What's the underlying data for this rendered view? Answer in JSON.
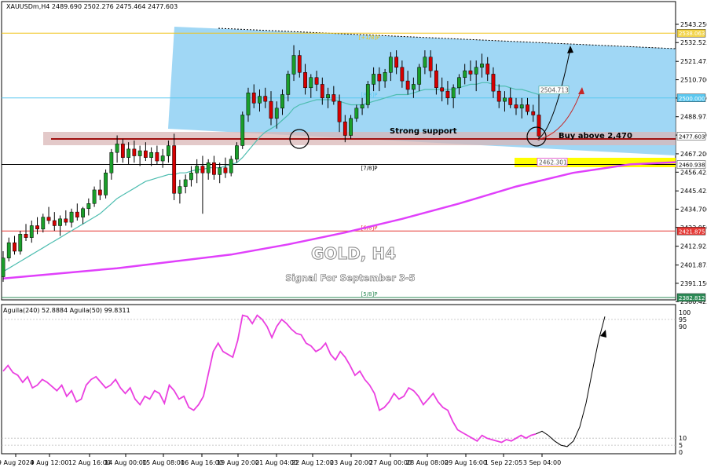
{
  "chart_data": {
    "type": "candlestick",
    "header": "XAUUSDm,H4  2489.690 2502.276 2475.464 2477.603",
    "title": "GOLD, H4",
    "subtitle": "Signal For September 3-5",
    "annotations": {
      "support": "Strong support",
      "buy": "Buy above 2,470"
    },
    "price_axis": {
      "ylim": [
        2380.5,
        2552
      ],
      "ticks": [
        "2543.250",
        "2532.525",
        "2521.475",
        "2510.700",
        "2499.950",
        "2488.975",
        "2478.200",
        "2467.200",
        "2456.425",
        "2445.425",
        "2434.700",
        "2423.950",
        "2412.925",
        "2401.875",
        "2391.150",
        "2380.425"
      ]
    },
    "price_tags": [
      {
        "value": 2538.063,
        "text": "2538.063",
        "bg": "#f2d44a",
        "fg": "#ffffff"
      },
      {
        "value": 2500.0,
        "text": "2500.000",
        "bg": "#5bc8f0",
        "fg": "#ffffff"
      },
      {
        "value": 2477.603,
        "text": "2477.603",
        "bg": "#ffffff",
        "fg": "#000000"
      },
      {
        "value": 2460.938,
        "text": "2460.938",
        "bg": "#ffffff",
        "fg": "#000000"
      },
      {
        "value": 2421.875,
        "text": "2421.875",
        "bg": "#e53935",
        "fg": "#ffffff"
      },
      {
        "value": 2382.812,
        "text": "2382.812",
        "bg": "#2e8b57",
        "fg": "#ffffff"
      }
    ],
    "murrey_levels": [
      {
        "label": "[+1/8]P",
        "value": 2538.063,
        "color": "#f0c419"
      },
      {
        "label": "[8/8]P",
        "value": 2500.0,
        "color": "#5bc8f0"
      },
      {
        "label": "[7/8]P",
        "value": 2460.938,
        "color": "#000000"
      },
      {
        "label": "[6/8]P",
        "value": 2421.875,
        "color": "#e53935"
      },
      {
        "label": "[5/8]P",
        "value": 2382.812,
        "color": "#2e8b57"
      }
    ],
    "ma_labels": [
      {
        "text": "2504.713",
        "value": 2504.713,
        "color": "#5ab4ac"
      },
      {
        "text": "2462.301",
        "value": 2462.301,
        "color": "#e040fb"
      }
    ],
    "candles": [
      [
        2395,
        2410,
        2392,
        2406
      ],
      [
        2406,
        2418,
        2404,
        2415
      ],
      [
        2415,
        2419,
        2408,
        2410
      ],
      [
        2410,
        2422,
        2408,
        2420
      ],
      [
        2420,
        2426,
        2416,
        2418
      ],
      [
        2418,
        2428,
        2415,
        2425
      ],
      [
        2425,
        2430,
        2420,
        2423
      ],
      [
        2423,
        2432,
        2421,
        2430
      ],
      [
        2430,
        2436,
        2426,
        2428
      ],
      [
        2428,
        2433,
        2422,
        2425
      ],
      [
        2425,
        2431,
        2419,
        2429
      ],
      [
        2429,
        2434,
        2425,
        2427
      ],
      [
        2427,
        2435,
        2424,
        2433
      ],
      [
        2433,
        2438,
        2428,
        2430
      ],
      [
        2430,
        2436,
        2426,
        2435
      ],
      [
        2435,
        2441,
        2431,
        2438
      ],
      [
        2438,
        2448,
        2436,
        2446
      ],
      [
        2446,
        2452,
        2440,
        2443
      ],
      [
        2443,
        2458,
        2441,
        2456
      ],
      [
        2456,
        2470,
        2452,
        2468
      ],
      [
        2468,
        2478,
        2462,
        2473
      ],
      [
        2473,
        2476,
        2462,
        2465
      ],
      [
        2465,
        2474,
        2461,
        2470
      ],
      [
        2470,
        2475,
        2462,
        2466
      ],
      [
        2466,
        2472,
        2460,
        2469
      ],
      [
        2469,
        2474,
        2463,
        2465
      ],
      [
        2465,
        2471,
        2460,
        2468
      ],
      [
        2468,
        2472,
        2461,
        2463
      ],
      [
        2463,
        2470,
        2459,
        2466
      ],
      [
        2466,
        2475,
        2462,
        2472
      ],
      [
        2472,
        2479,
        2440,
        2444
      ],
      [
        2444,
        2452,
        2438,
        2448
      ],
      [
        2448,
        2455,
        2444,
        2452
      ],
      [
        2452,
        2460,
        2448,
        2456
      ],
      [
        2456,
        2464,
        2450,
        2460
      ],
      [
        2460,
        2466,
        2432,
        2456
      ],
      [
        2456,
        2464,
        2452,
        2462
      ],
      [
        2462,
        2466,
        2452,
        2455
      ],
      [
        2455,
        2462,
        2450,
        2459
      ],
      [
        2459,
        2465,
        2453,
        2456
      ],
      [
        2456,
        2466,
        2454,
        2464
      ],
      [
        2464,
        2474,
        2462,
        2472
      ],
      [
        2472,
        2492,
        2470,
        2490
      ],
      [
        2490,
        2506,
        2486,
        2503
      ],
      [
        2503,
        2508,
        2494,
        2497
      ],
      [
        2497,
        2505,
        2492,
        2501
      ],
      [
        2501,
        2506,
        2494,
        2498
      ],
      [
        2498,
        2504,
        2484,
        2488
      ],
      [
        2488,
        2498,
        2482,
        2494
      ],
      [
        2494,
        2505,
        2490,
        2502
      ],
      [
        2502,
        2516,
        2498,
        2514
      ],
      [
        2514,
        2531,
        2510,
        2525
      ],
      [
        2525,
        2528,
        2512,
        2515
      ],
      [
        2515,
        2520,
        2502,
        2506
      ],
      [
        2506,
        2514,
        2500,
        2512
      ],
      [
        2512,
        2516,
        2504,
        2508
      ],
      [
        2508,
        2512,
        2496,
        2500
      ],
      [
        2500,
        2506,
        2494,
        2502
      ],
      [
        2502,
        2507,
        2496,
        2498
      ],
      [
        2498,
        2502,
        2480,
        2486
      ],
      [
        2486,
        2490,
        2474,
        2478
      ],
      [
        2478,
        2490,
        2476,
        2488
      ],
      [
        2488,
        2496,
        2486,
        2494
      ],
      [
        2494,
        2500,
        2490,
        2496
      ],
      [
        2496,
        2510,
        2494,
        2508
      ],
      [
        2508,
        2518,
        2504,
        2514
      ],
      [
        2514,
        2518,
        2504,
        2510
      ],
      [
        2510,
        2517,
        2506,
        2515
      ],
      [
        2515,
        2527,
        2510,
        2524
      ],
      [
        2524,
        2528,
        2514,
        2518
      ],
      [
        2518,
        2522,
        2506,
        2510
      ],
      [
        2510,
        2516,
        2502,
        2505
      ],
      [
        2505,
        2512,
        2500,
        2508
      ],
      [
        2508,
        2520,
        2504,
        2518
      ],
      [
        2518,
        2528,
        2514,
        2524
      ],
      [
        2524,
        2528,
        2512,
        2516
      ],
      [
        2516,
        2520,
        2502,
        2506
      ],
      [
        2506,
        2512,
        2498,
        2504
      ],
      [
        2504,
        2510,
        2496,
        2500
      ],
      [
        2500,
        2508,
        2494,
        2506
      ],
      [
        2506,
        2514,
        2502,
        2512
      ],
      [
        2512,
        2520,
        2508,
        2516
      ],
      [
        2516,
        2522,
        2510,
        2514
      ],
      [
        2514,
        2522,
        2504,
        2518
      ],
      [
        2518,
        2526,
        2512,
        2520
      ],
      [
        2520,
        2524,
        2510,
        2514
      ],
      [
        2514,
        2518,
        2500,
        2504
      ],
      [
        2504,
        2508,
        2494,
        2498
      ],
      [
        2498,
        2504,
        2492,
        2500
      ],
      [
        2500,
        2506,
        2494,
        2496
      ],
      [
        2496,
        2500,
        2490,
        2494
      ],
      [
        2494,
        2500,
        2488,
        2496
      ],
      [
        2496,
        2500,
        2490,
        2492
      ],
      [
        2492,
        2496,
        2486,
        2490
      ],
      [
        2490,
        2502,
        2475,
        2477.6
      ]
    ],
    "ema_blue": [
      2398,
      2400,
      2402,
      2404,
      2406,
      2408,
      2410,
      2412,
      2414,
      2416,
      2418,
      2420,
      2422,
      2424,
      2426,
      2428,
      2430,
      2432,
      2435,
      2438,
      2441,
      2443,
      2445,
      2447,
      2449,
      2451,
      2452,
      2453,
      2454,
      2455,
      2455,
      2456,
      2456,
      2457,
      2458,
      2458,
      2459,
      2459,
      2459,
      2460,
      2461,
      2462,
      2465,
      2469,
      2473,
      2477,
      2480,
      2482,
      2484,
      2487,
      2490,
      2494,
      2496,
      2497,
      2498,
      2499,
      2499,
      2499,
      2499,
      2498,
      2497,
      2496,
      2496,
      2496,
      2497,
      2498,
      2499,
      2500,
      2501,
      2502,
      2502,
      2502,
      2503,
      2504,
      2505,
      2505,
      2505,
      2505,
      2505,
      2505,
      2506,
      2507,
      2508,
      2508,
      2509,
      2509,
      2508,
      2507,
      2507,
      2506,
      2505,
      2505,
      2504,
      2503,
      2502,
      2504.7
    ],
    "ema_magenta_points": [
      [
        0,
        2394
      ],
      [
        10,
        2397
      ],
      [
        20,
        2400
      ],
      [
        30,
        2404
      ],
      [
        40,
        2408
      ],
      [
        50,
        2414
      ],
      [
        60,
        2421
      ],
      [
        70,
        2429
      ],
      [
        80,
        2438
      ],
      [
        90,
        2448
      ],
      [
        100,
        2456
      ],
      [
        110,
        2461
      ],
      [
        118,
        2462.3
      ]
    ],
    "oscillator": {
      "label": "Aguila(240) 52.8884  Aguila(50) 99.8311",
      "ticks": [
        "100",
        "95",
        "90",
        "10",
        "5",
        "0"
      ],
      "values": [
        58,
        62,
        57,
        55,
        50,
        54,
        46,
        48,
        52,
        50,
        47,
        44,
        48,
        40,
        44,
        36,
        38,
        48,
        52,
        54,
        50,
        46,
        48,
        52,
        46,
        42,
        46,
        38,
        34,
        40,
        38,
        44,
        42,
        35,
        48,
        44,
        38,
        40,
        32,
        30,
        34,
        40,
        56,
        72,
        78,
        72,
        70,
        68,
        80,
        98,
        97,
        92,
        98,
        95,
        90,
        82,
        90,
        95,
        92,
        88,
        85,
        84,
        78,
        76,
        72,
        74,
        78,
        70,
        66,
        72,
        68,
        62,
        55,
        58,
        52,
        48,
        42,
        30,
        32,
        36,
        42,
        38,
        40,
        46,
        44,
        40,
        34,
        38,
        42,
        36,
        32,
        30,
        22,
        16,
        14,
        12,
        10,
        8,
        12,
        10,
        9,
        8,
        7,
        9,
        8,
        10,
        12,
        10,
        12,
        13
      ],
      "projection": [
        13,
        15,
        12,
        8,
        5,
        4,
        8,
        18,
        35,
        58,
        80,
        97
      ]
    },
    "x_labels": [
      "9 Aug 2024",
      "9 Aug 12:00",
      "12 Aug 16:00",
      "14 Aug 00:00",
      "15 Aug 08:00",
      "16 Aug 16:00",
      "19 Aug 20:00",
      "21 Aug 04:00",
      "22 Aug 12:00",
      "23 Aug 20:00",
      "27 Aug 00:00",
      "28 Aug 08:00",
      "29 Aug 16:00",
      "1 Sep 22:05",
      "3 Sep 04:00"
    ],
    "murrey_label_color_8_8": "#5bc8f0"
  }
}
